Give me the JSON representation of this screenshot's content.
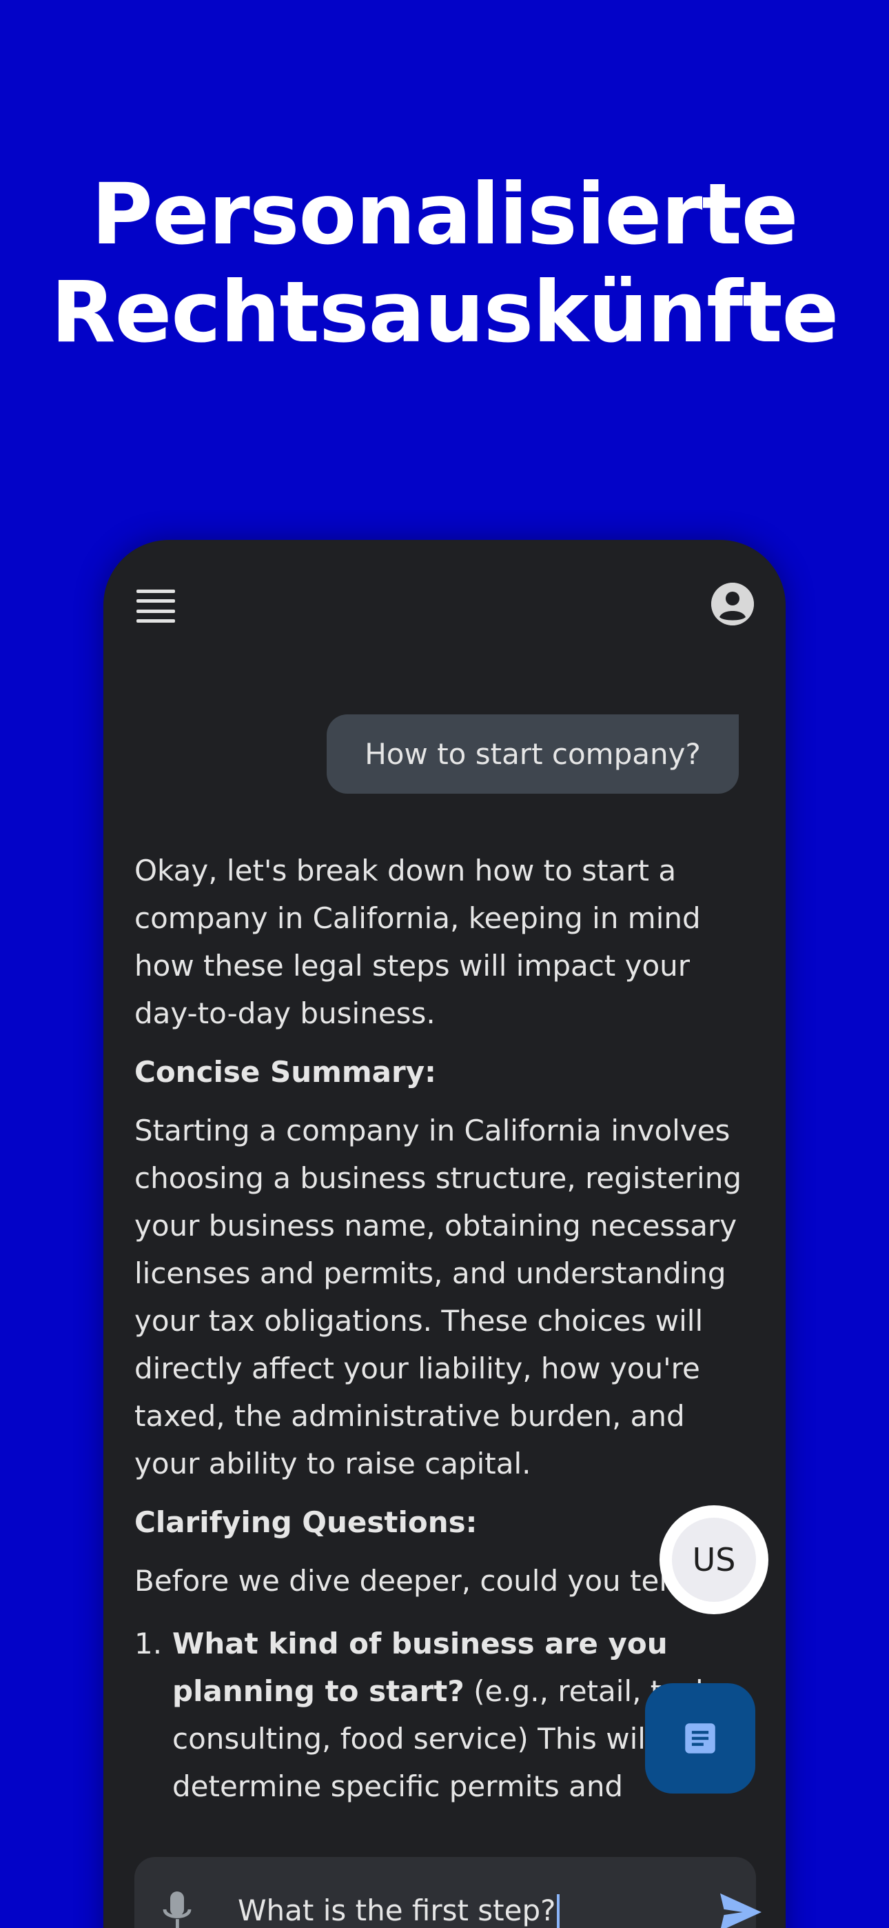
{
  "headline": {
    "line1": "Personalisierte",
    "line2": "Rechtsauskünfte"
  },
  "chat": {
    "user_message": "How to start company?",
    "answer": {
      "intro": "Okay, let's break down how to start a company in California, keeping in mind how these legal steps will impact your day-to-day business.",
      "summary_heading": "Concise Summary:",
      "summary_text": "Starting a company in California involves choosing a business structure, registering your business name, obtaining necessary licenses and permits, and understanding your tax obligations. These choices will directly affect your liability, how you're taxed, the administrative burden, and your ability to raise capital.",
      "questions_heading": "Clarifying Questions:",
      "questions_intro": "Before we dive deeper, could you tell me:",
      "questions": [
        {
          "number": "1.",
          "bold": "What kind of business are you planning to start?",
          "rest": " (e.g., retail, tech, consulting, food service) This will help determine specific permits and"
        }
      ]
    }
  },
  "region_button": {
    "label": "US"
  },
  "input": {
    "value": "What is the first step?"
  },
  "icons": {
    "menu": "menu-icon",
    "profile": "account-circle-icon",
    "document": "document-icon",
    "mic": "mic-icon",
    "send": "send-icon"
  },
  "colors": {
    "background": "#0303c8",
    "phone_surface": "#1f2023",
    "user_bubble": "#3f464f",
    "doc_button": "#0a4d8c",
    "accent": "#8ab4f8"
  }
}
